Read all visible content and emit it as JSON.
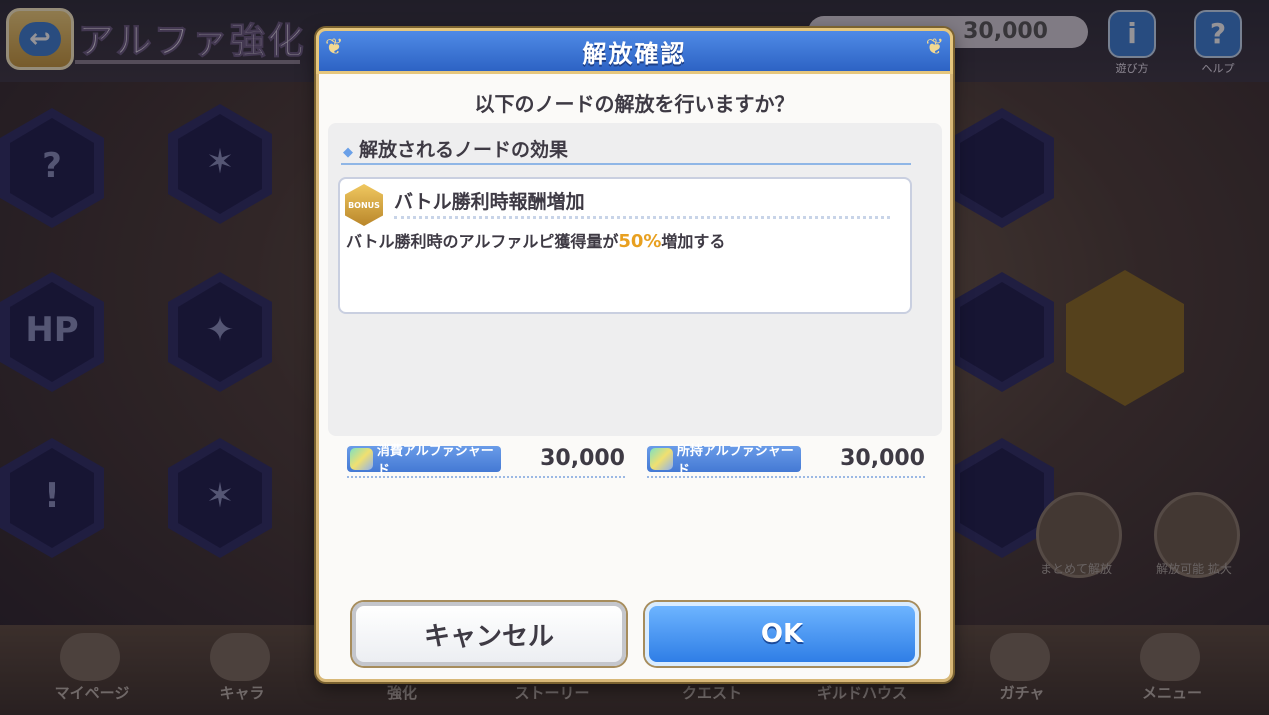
{
  "background": {
    "screen_title": "アルファ強化",
    "currency_value": "30,000",
    "header_buttons": [
      {
        "label": "遊び方"
      },
      {
        "label": "ヘルプ"
      }
    ],
    "side_buttons": [
      {
        "label": "まとめて解放"
      },
      {
        "label": "解放可能 拡大"
      }
    ],
    "nav": [
      {
        "label": "マイページ"
      },
      {
        "label": "キャラ"
      },
      {
        "label": "強化"
      },
      {
        "label": "ストーリー"
      },
      {
        "label": "クエスト"
      },
      {
        "label": "ギルドハウス"
      },
      {
        "label": "ガチャ"
      },
      {
        "label": "メニュー"
      }
    ]
  },
  "dialog": {
    "title": "解放確認",
    "question": "以下のノードの解放を行いますか？",
    "effects_heading": "解放されるノードの効果",
    "node": {
      "badge_text": "BONUS",
      "name": "バトル勝利時報酬増加",
      "desc_before": "バトル勝利時のアルファルピ獲得量が",
      "desc_highlight": "50%",
      "desc_after": "増加する"
    },
    "cost": {
      "label": "消費アルファシャード",
      "value": "30,000"
    },
    "owned": {
      "label": "所持アルファシャード",
      "value": "30,000"
    },
    "cancel_label": "キャンセル",
    "ok_label": "OK"
  },
  "colors": {
    "header_blue": "#2d63c4",
    "ok_blue": "#2f7ee6",
    "highlight_orange": "#e8a020",
    "frame_gold": "#d8b878"
  }
}
